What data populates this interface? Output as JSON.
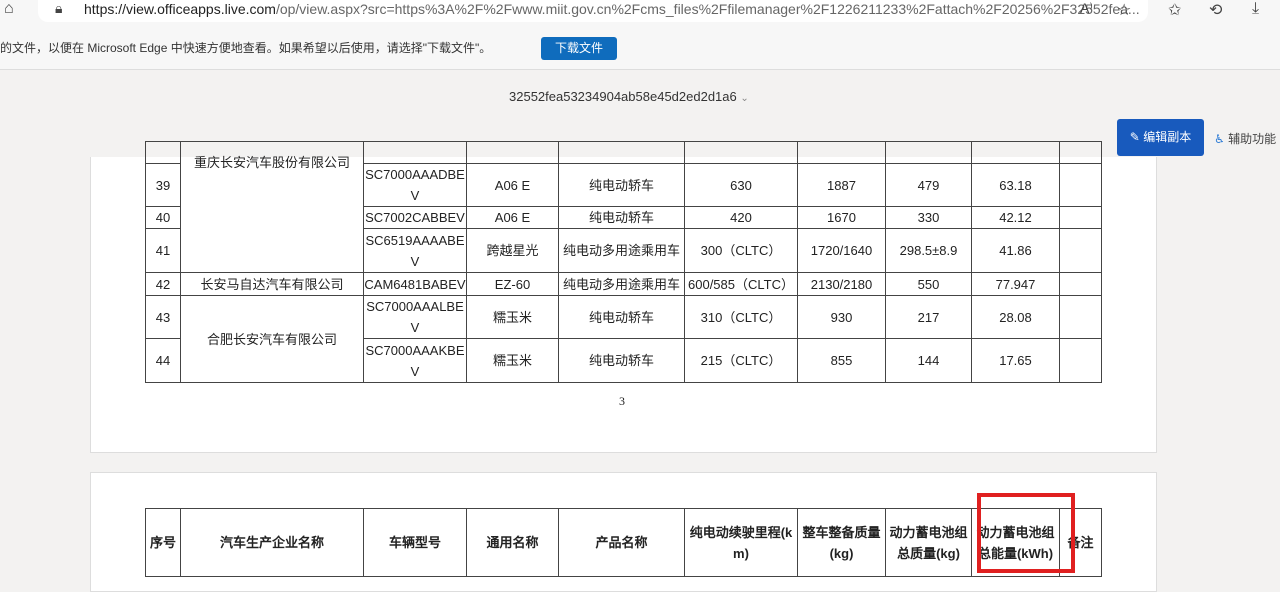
{
  "browser": {
    "url_host": "https://view.officeapps.live.com",
    "url_rest": "/op/view.aspx?src=https%3A%2F%2Fwww.miit.gov.cn%2Fcms_files%2Ffilemanager%2F1226211233%2Fattach%2F20256%2F32552fea..."
  },
  "infobar": {
    "message": "的文件，以便在 Microsoft Edge 中快速方便地查看。如果希望以后使用，请选择\"下载文件\"。",
    "download_label": "下载文件"
  },
  "doc": {
    "title": "32552fea53234904ab58e45d2ed2d1a6",
    "edit_label": "编辑副本",
    "assist_label": "辅助功能"
  },
  "page_number": "3",
  "companies": {
    "c1": "重庆长安汽车股份有限公司",
    "c2": "长安马自达汽车有限公司",
    "c3": "合肥长安汽车有限公司"
  },
  "rows": [
    {
      "no": "39",
      "model": "SC7000AAADBEV",
      "name": "A06 E",
      "product": "纯电动轿车",
      "range": "630",
      "mass": "1887",
      "battery_mass": "479",
      "energy": "63.18",
      "note": ""
    },
    {
      "no": "40",
      "model": "SC7002CABBEV",
      "name": "A06 E",
      "product": "纯电动轿车",
      "range": "420",
      "mass": "1670",
      "battery_mass": "330",
      "energy": "42.12",
      "note": ""
    },
    {
      "no": "41",
      "model": "SC6519AAAABEV",
      "name": "跨越星光",
      "product": "纯电动多用途乘用车",
      "range": "300（CLTC）",
      "mass": "1720/1640",
      "battery_mass": "298.5±8.9",
      "energy": "41.86",
      "note": ""
    },
    {
      "no": "42",
      "model": "CAM6481BABEV",
      "name": "EZ-60",
      "product": "纯电动多用途乘用车",
      "range": "600/585（CLTC）",
      "mass": "2130/2180",
      "battery_mass": "550",
      "energy": "77.947",
      "note": ""
    },
    {
      "no": "43",
      "model": "SC7000AAALBEV",
      "name": "糯玉米",
      "product": "纯电动轿车",
      "range": "310（CLTC）",
      "mass": "930",
      "battery_mass": "217",
      "energy": "28.08",
      "note": ""
    },
    {
      "no": "44",
      "model": "SC7000AAAKBEV",
      "name": "糯玉米",
      "product": "纯电动轿车",
      "range": "215（CLTC）",
      "mass": "855",
      "battery_mass": "144",
      "energy": "17.65",
      "note": ""
    }
  ],
  "headers": [
    "序号",
    "汽车生产企业名称",
    "车辆型号",
    "通用名称",
    "产品名称",
    "纯电动续驶里程(km)",
    "整车整备质量(kg)",
    "动力蓄电池组总质量(kg)",
    "动力蓄电池组总能量(kWh)",
    "备注"
  ]
}
